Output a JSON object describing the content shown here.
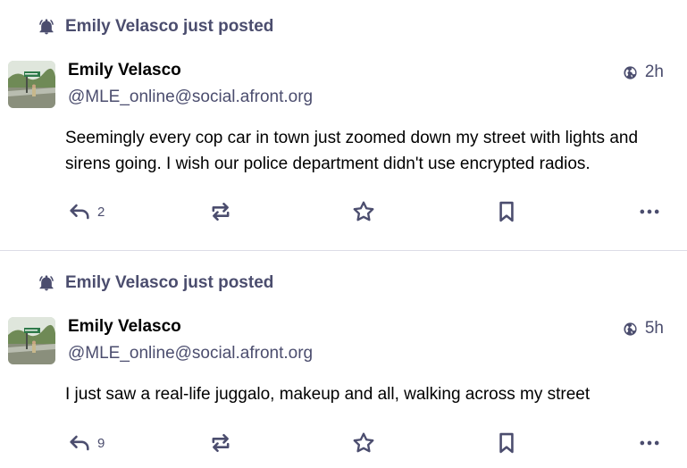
{
  "posts": [
    {
      "prepend": "Emily Velasco just posted",
      "display_name": "Emily Velasco",
      "handle": "@MLE_online@social.afront.org",
      "time": "2h",
      "content": "Seemingly every cop car in town just zoomed down my street with lights and sirens going. I wish our police department didn't use encrypted radios.",
      "reply_count": "2"
    },
    {
      "prepend": "Emily Velasco just posted",
      "display_name": "Emily Velasco",
      "handle": "@MLE_online@social.afront.org",
      "time": "5h",
      "content": "I just saw a real-life juggalo, makeup and all, walking across my street",
      "reply_count": "9"
    }
  ],
  "icons": {
    "prepend": "bell-icon",
    "visibility": "globe-icon",
    "reply": "reply-icon",
    "boost": "boost-icon",
    "favourite": "star-icon",
    "bookmark": "bookmark-icon",
    "more": "more-icon"
  },
  "colors": {
    "secondary_text": "#4b4d6e",
    "divider": "#dcdde6",
    "background": "#ffffff"
  }
}
